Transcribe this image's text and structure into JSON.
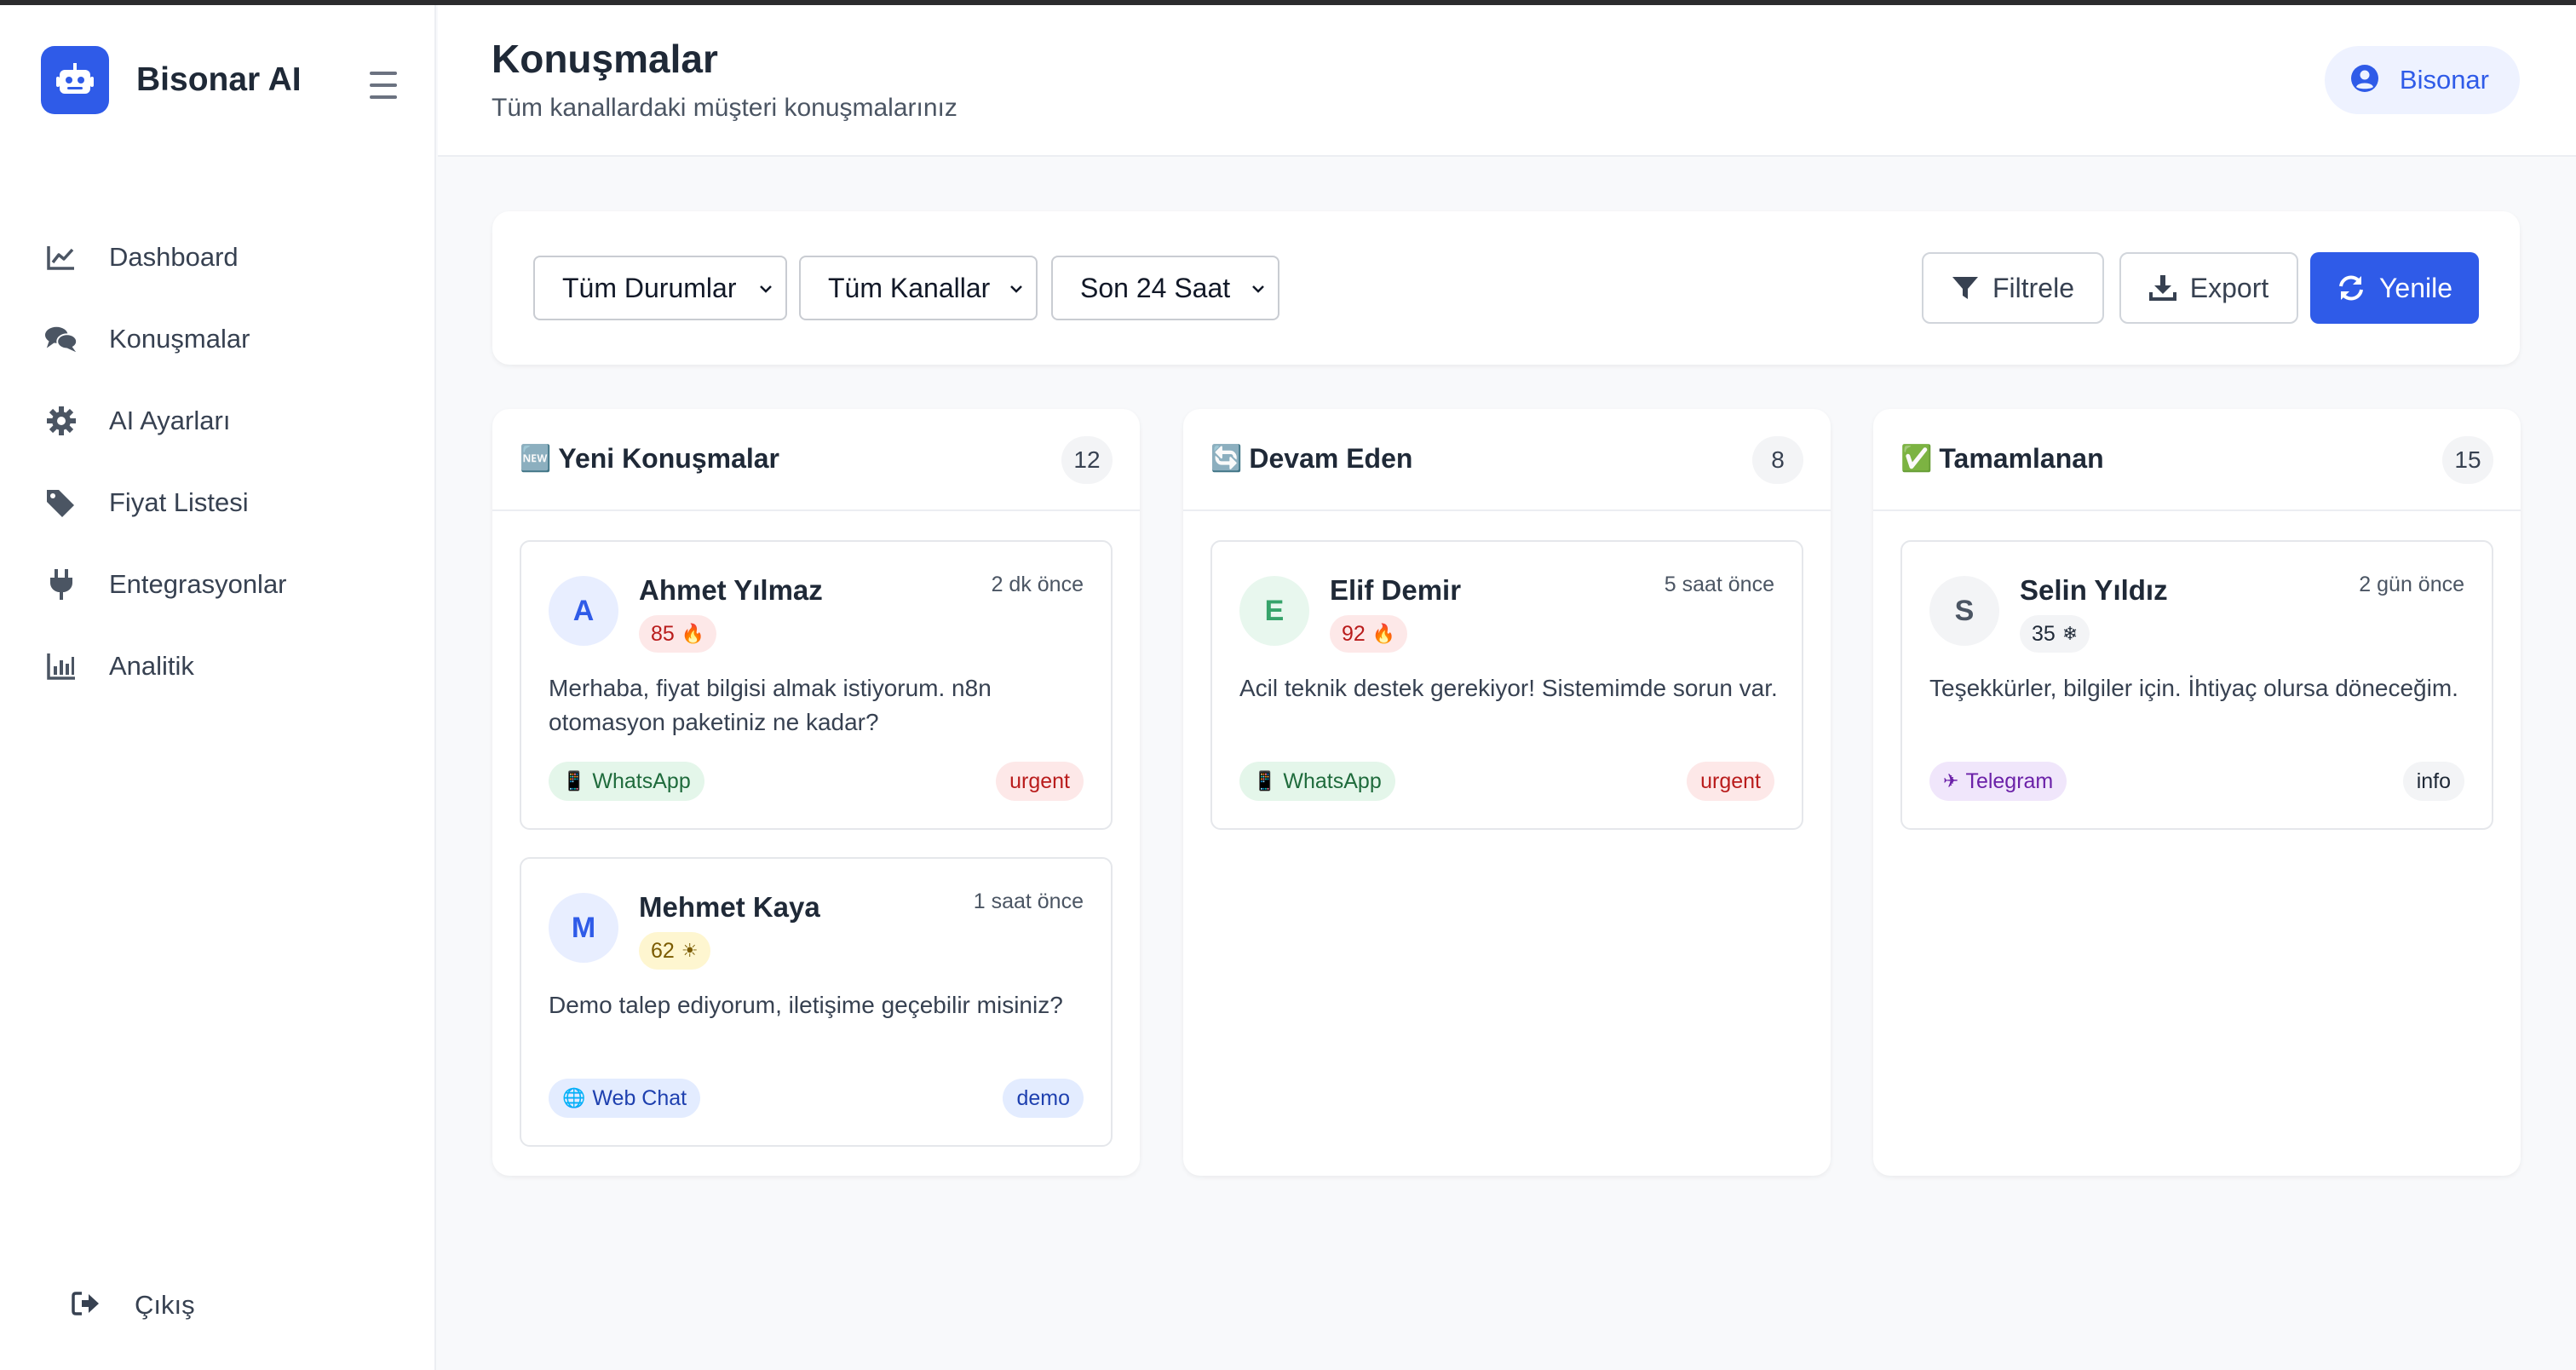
{
  "app": {
    "name": "Bisonar AI",
    "user_label": "Bisonar"
  },
  "sidebar": {
    "items": [
      {
        "label": "Dashboard",
        "icon": "chart-line-icon"
      },
      {
        "label": "Konuşmalar",
        "icon": "comments-icon"
      },
      {
        "label": "AI Ayarları",
        "icon": "gear-icon"
      },
      {
        "label": "Fiyat Listesi",
        "icon": "tags-icon"
      },
      {
        "label": "Entegrasyonlar",
        "icon": "plug-icon"
      },
      {
        "label": "Analitik",
        "icon": "bar-chart-icon"
      }
    ],
    "logout_label": "Çıkış"
  },
  "header": {
    "title": "Konuşmalar",
    "subtitle": "Tüm kanallardaki müşteri konuşmalarınız"
  },
  "filters": {
    "status": "Tüm Durumlar",
    "channel": "Tüm Kanallar",
    "period": "Son 24 Saat",
    "filter_label": "Filtrele",
    "export_label": "Export",
    "refresh_label": "Yenile"
  },
  "colors": {
    "accent": "#2f5be8",
    "urgent": "#b91c1c",
    "whatsapp": "#1f6b3c",
    "telegram": "#6b21a8"
  },
  "columns": [
    {
      "title": "Yeni Konuşmalar",
      "emoji": "🆕",
      "count": "12",
      "cards": [
        {
          "initial": "A",
          "name": "Ahmet Yılmaz",
          "time": "2 dk önce",
          "score": "85",
          "score_icon": "🔥",
          "message": "Merhaba, fiyat bilgisi almak istiyorum. n8n otomasyon paketiniz ne kadar?",
          "channel": "WhatsApp",
          "channel_icon": "📱",
          "tag": "urgent"
        },
        {
          "initial": "M",
          "name": "Mehmet Kaya",
          "time": "1 saat önce",
          "score": "62",
          "score_icon": "☀",
          "message": "Demo talep ediyorum, iletişime geçebilir misiniz?",
          "channel": "Web Chat",
          "channel_icon": "🌐",
          "tag": "demo"
        }
      ]
    },
    {
      "title": "Devam Eden",
      "emoji": "🔄",
      "count": "8",
      "cards": [
        {
          "initial": "E",
          "name": "Elif Demir",
          "time": "5 saat önce",
          "score": "92",
          "score_icon": "🔥",
          "message": "Acil teknik destek gerekiyor! Sistemimde sorun var.",
          "channel": "WhatsApp",
          "channel_icon": "📱",
          "tag": "urgent"
        }
      ]
    },
    {
      "title": "Tamamlanan",
      "emoji": "✅",
      "count": "15",
      "cards": [
        {
          "initial": "S",
          "name": "Selin Yıldız",
          "time": "2 gün önce",
          "score": "35",
          "score_icon": "❄",
          "message": "Teşekkürler, bilgiler için. İhtiyaç olursa döneceğim.",
          "channel": "Telegram",
          "channel_icon": "✈",
          "tag": "info"
        }
      ]
    }
  ]
}
